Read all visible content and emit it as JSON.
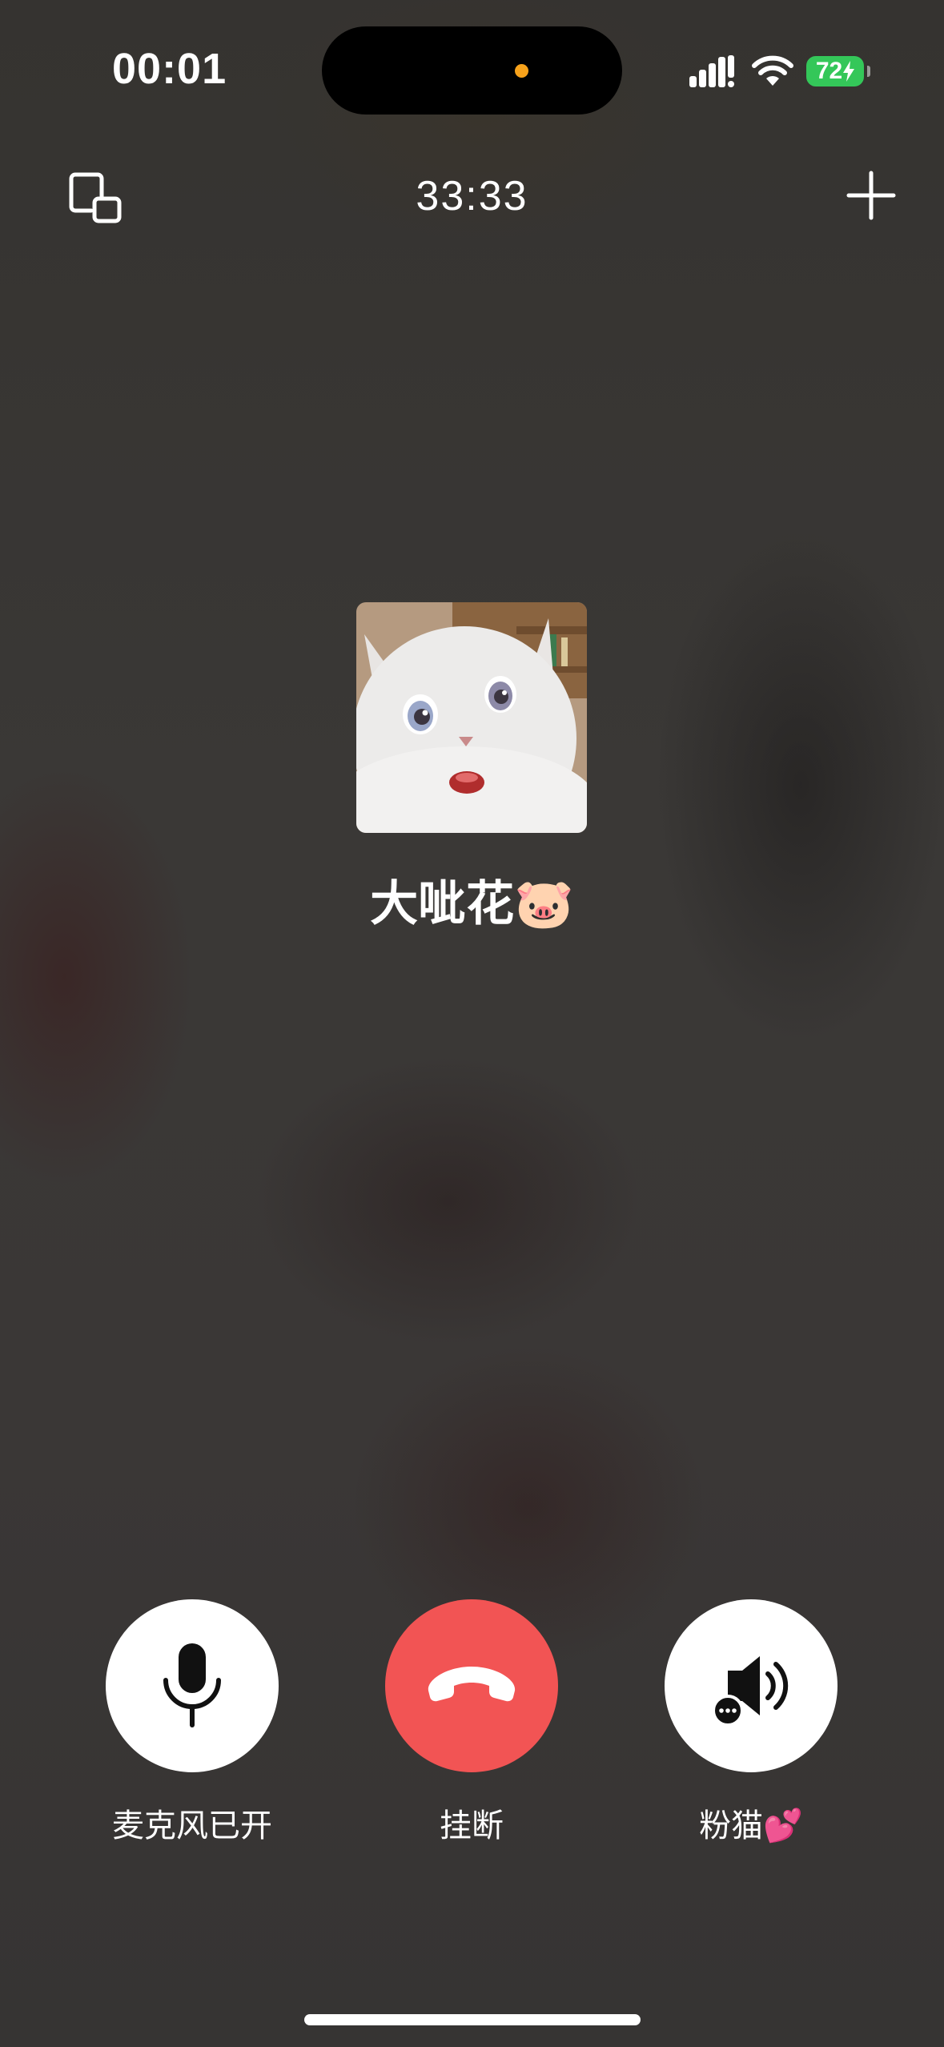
{
  "status_bar": {
    "time": "00:01",
    "battery_level": "72",
    "icons": [
      "signal-icon",
      "wifi-icon",
      "battery-charging-icon"
    ]
  },
  "top_bar": {
    "call_duration": "33:33",
    "left_icon": "minimize-window-icon",
    "right_icon": "add-icon"
  },
  "caller": {
    "name": "大呲花🐷",
    "avatar_icon": "white-cat-avatar"
  },
  "controls": {
    "mic_label": "麦克风已开",
    "hangup_label": "挂断",
    "speaker_label": "粉猫💕"
  },
  "colors": {
    "hangup_red": "#f25454",
    "battery_green": "#34c759",
    "island_dot": "#f7a21b"
  }
}
